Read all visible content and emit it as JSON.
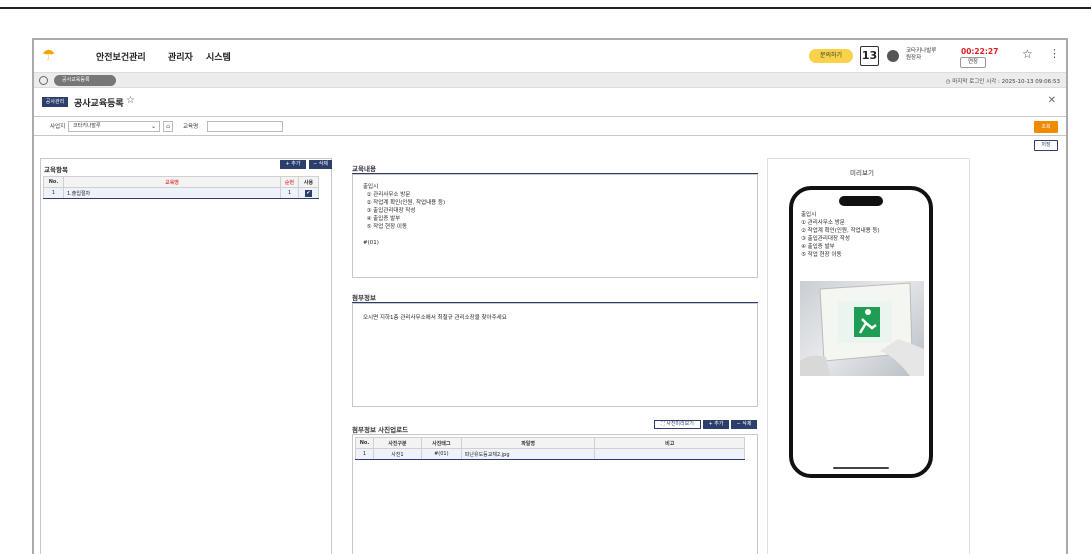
{
  "header": {
    "nav": [
      "안전보건관리",
      "관리자",
      "시스템"
    ],
    "inquiry_label": "문의하기",
    "calendar_day": "13",
    "user_line1": "코타키나발루",
    "user_line2": "원장자",
    "timer": "00:22:27",
    "extend_label": "연장"
  },
  "tabbar": {
    "tab_label": "공사교육등록",
    "last_login": "마지막 로그인 시각 : 2025-10-13 09:06:53"
  },
  "title": {
    "badge": "공사관리",
    "page_title": "공사교육등록"
  },
  "filter": {
    "site_label": "사업지",
    "site_value": "코타키나발루",
    "edu_label": "교육명",
    "edu_value": "",
    "search_label": "조회",
    "save_label": "저장"
  },
  "edu_list": {
    "title": "교육항목",
    "add_label": "+ 추가",
    "delete_label": "− 삭제",
    "columns": [
      "No.",
      "교육명",
      "순번",
      "사용"
    ],
    "rows": [
      {
        "no": "1",
        "name": "1.출입절차",
        "order": "1",
        "use": "✔"
      }
    ]
  },
  "content": {
    "title": "교육내용",
    "body": "출입시\n  ① 관리사무소 방문\n  ② 작업계 확인(인원, 작업내용 등)\n  ③ 출입관리대장 작성\n  ④ 출입증 발부\n  ⑤ 작업 현장 이동\n\n#(01)"
  },
  "extra": {
    "title": "첨부정보",
    "body": "오시면 지하1층 관리사무소에서 최철규 관리소장을 찾아주세요"
  },
  "photo_upload": {
    "title": "첨부정보 사진업로드",
    "preview_label": "사진미리보기",
    "add_label": "+ 추가",
    "delete_label": "− 삭제",
    "columns": [
      "No.",
      "사진구분",
      "사진태그",
      "파일명",
      "비고"
    ],
    "rows": [
      {
        "no": "1",
        "type": "사진1",
        "tag": "#(01)",
        "file": "피난유도등교체2.jpg",
        "note": ""
      }
    ]
  },
  "preview": {
    "title": "미리보기",
    "text": "출입시\n① 관리사무소 방문\n② 작업계 확인(인원, 작업내용 등)\n③ 출입관리대장 작성\n④ 출입증 발부\n⑤ 작업 현장 이동"
  },
  "icons": [
    "umbrella-logo-icon",
    "calendar-icon",
    "user-avatar-icon",
    "star-icon",
    "kebab-menu-icon",
    "clock-icon",
    "home-icon",
    "close-icon",
    "chevron-down-icon",
    "image-icon"
  ],
  "colors": {
    "accent": "#2c3e6b",
    "orange": "#f08a00",
    "yellow": "#f8d34a",
    "red": "#e02020"
  }
}
